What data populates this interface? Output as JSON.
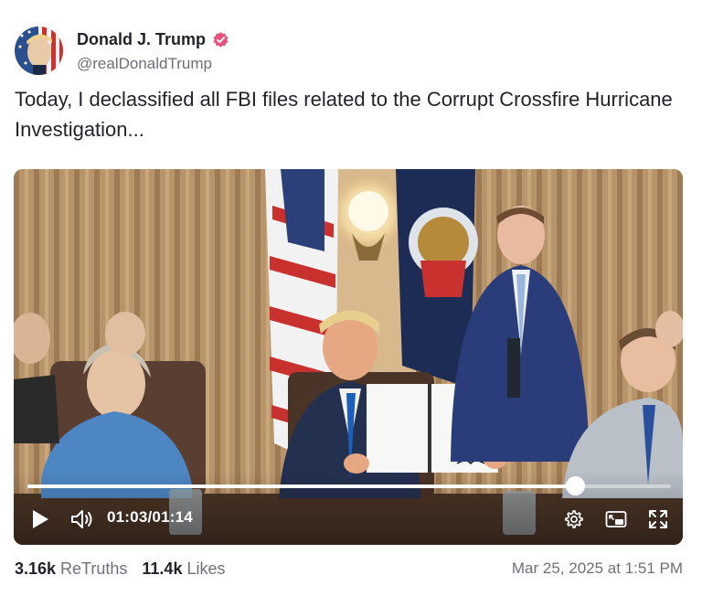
{
  "author": {
    "display_name": "Donald J. Trump",
    "handle": "@realDonaldTrump",
    "verified": true,
    "avatar_icon": "profile-avatar",
    "verified_icon": "verified-badge-icon",
    "verified_color": "#e8537d"
  },
  "post": {
    "text": "Today, I declassified all FBI files related to the Corrupt Crossfire Hurricane Investigation..."
  },
  "video": {
    "current_time": "01:03",
    "separator": "/",
    "duration": "01:14",
    "progress_fraction": 0.851,
    "controls": {
      "play_icon": "play-icon",
      "volume_icon": "volume-icon",
      "settings_icon": "gear-icon",
      "pip_icon": "picture-in-picture-icon",
      "fullscreen_icon": "fullscreen-icon"
    }
  },
  "stats": {
    "retruths_count": "3.16k",
    "retruths_label": "ReTruths",
    "likes_count": "11.4k",
    "likes_label": "Likes",
    "timestamp": "Mar 25, 2025 at 1:51 PM"
  }
}
